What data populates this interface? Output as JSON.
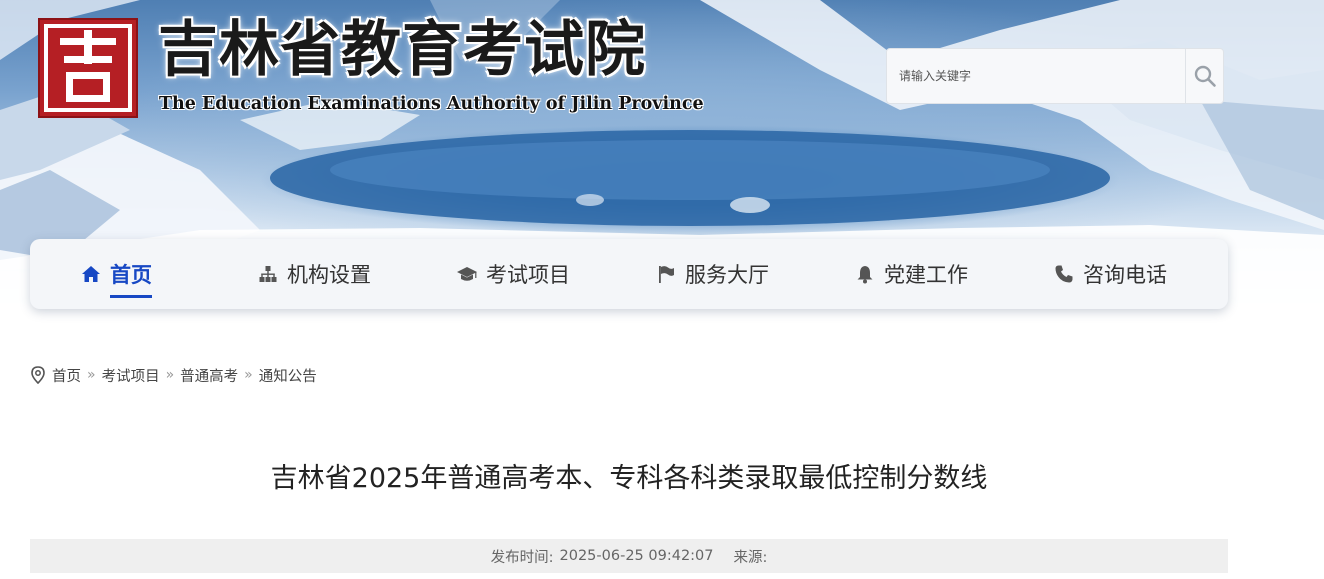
{
  "header": {
    "logo_char": "吉",
    "title": "吉林省教育考试院",
    "subtitle": "The Education Examinations Authority of Jilin Province",
    "brand_red": "#b51f24"
  },
  "search": {
    "placeholder": "请输入关键字",
    "button_icon": "search-icon"
  },
  "nav": {
    "accent_color": "#1748c4",
    "items": [
      {
        "label": "首页",
        "icon": "home-icon",
        "active": true
      },
      {
        "label": "机构设置",
        "icon": "sitemap-icon",
        "active": false
      },
      {
        "label": "考试项目",
        "icon": "graduation-cap-icon",
        "active": false
      },
      {
        "label": "服务大厅",
        "icon": "flag-icon",
        "active": false
      },
      {
        "label": "党建工作",
        "icon": "bell-icon",
        "active": false
      },
      {
        "label": "咨询电话",
        "icon": "phone-icon",
        "active": false
      }
    ]
  },
  "breadcrumb": {
    "icon": "location-pin-icon",
    "items": [
      "首页",
      "考试项目",
      "普通高考",
      "通知公告"
    ],
    "separator": "»"
  },
  "article": {
    "title": "吉林省2025年普通高考本、专科各科类录取最低控制分数线",
    "publish_label": "发布时间:",
    "publish_time": "2025-06-25 09:42:07",
    "source_label": "来源:"
  }
}
